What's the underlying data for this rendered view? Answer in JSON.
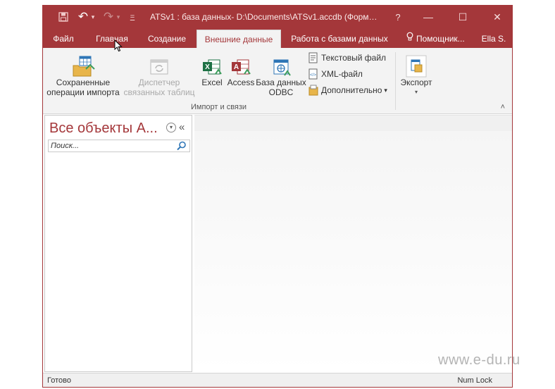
{
  "titlebar": {
    "title": "ATSv1 : база данных- D:\\Documents\\ATSv1.accdb (Форм…",
    "help": "?",
    "minimize": "—",
    "maximize": "☐",
    "close": "✕"
  },
  "qat": {
    "undo": "↶",
    "undo_arrow": "▾",
    "redo": "↷",
    "redo_arrow": "▾",
    "customize": "="
  },
  "tabs": [
    "Файл",
    "Главная",
    "Создание",
    "Внешние данные",
    "Работа с базами данных",
    "Помощник...",
    "Ella S."
  ],
  "ribbon": {
    "saved_imports": "Сохраненные операции импорта",
    "linked_tables": "Диспетчер связанных таблиц",
    "excel": "Excel",
    "access": "Access",
    "odbc": "База данных ODBC",
    "text_file": "Текстовый файл",
    "xml_file": "XML-файл",
    "more": "Дополнительно",
    "export": "Экспорт",
    "group_label": "Импорт и связи",
    "collapse": "˄",
    "dropdown_arrow": "▾"
  },
  "nav": {
    "title": "Все объекты A...",
    "dropdown": "▾",
    "collapse": "«",
    "search_placeholder": "Поиск..."
  },
  "status": {
    "left": "Готово",
    "right": "Num Lock"
  },
  "watermark": "www.e-du.ru",
  "colors": {
    "accent": "#a4373a",
    "ribbon": "#f3f3f3",
    "excel": "#1e7145",
    "access": "#a4373a"
  }
}
